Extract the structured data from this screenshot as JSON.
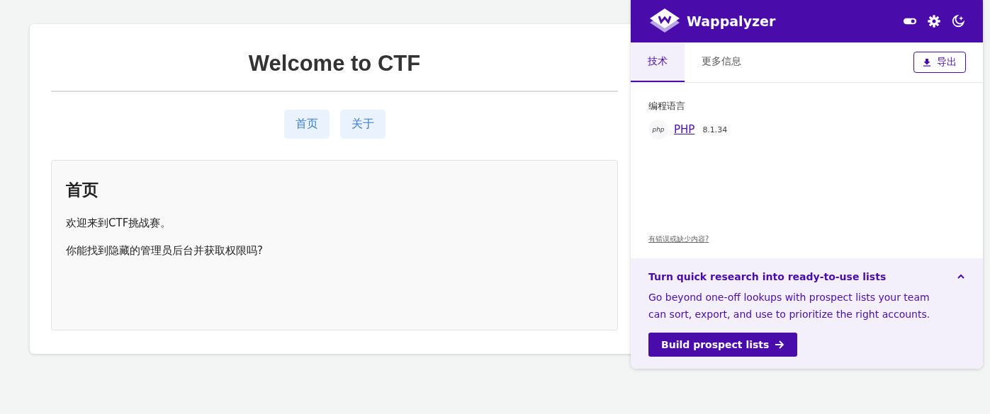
{
  "page": {
    "title": "Welcome to CTF",
    "nav": [
      {
        "label": "首页"
      },
      {
        "label": "关于"
      }
    ],
    "panel": {
      "heading": "首页",
      "paragraphs": [
        "欢迎来到CTF挑战赛。",
        "你能找到隐藏的管理员后台并获取权限吗?"
      ]
    }
  },
  "popup": {
    "brand": "Wappalyzer",
    "tabs": [
      {
        "label": "技术",
        "selected": true
      },
      {
        "label": "更多信息",
        "selected": false
      }
    ],
    "export_button": "导出",
    "categories": [
      {
        "name": "编程语言",
        "technologies": [
          {
            "icon_text": "php",
            "name": "PHP",
            "version": "8.1.34"
          }
        ]
      }
    ],
    "feedback_link": "有错误或缺少内容?",
    "promo": {
      "title": "Turn quick research into ready-to-use lists",
      "expanded": true,
      "text": "Go beyond one-off lookups with prospect lists your team can sort, export, and use to prioritize the right accounts.",
      "button": "Build prospect lists"
    }
  }
}
